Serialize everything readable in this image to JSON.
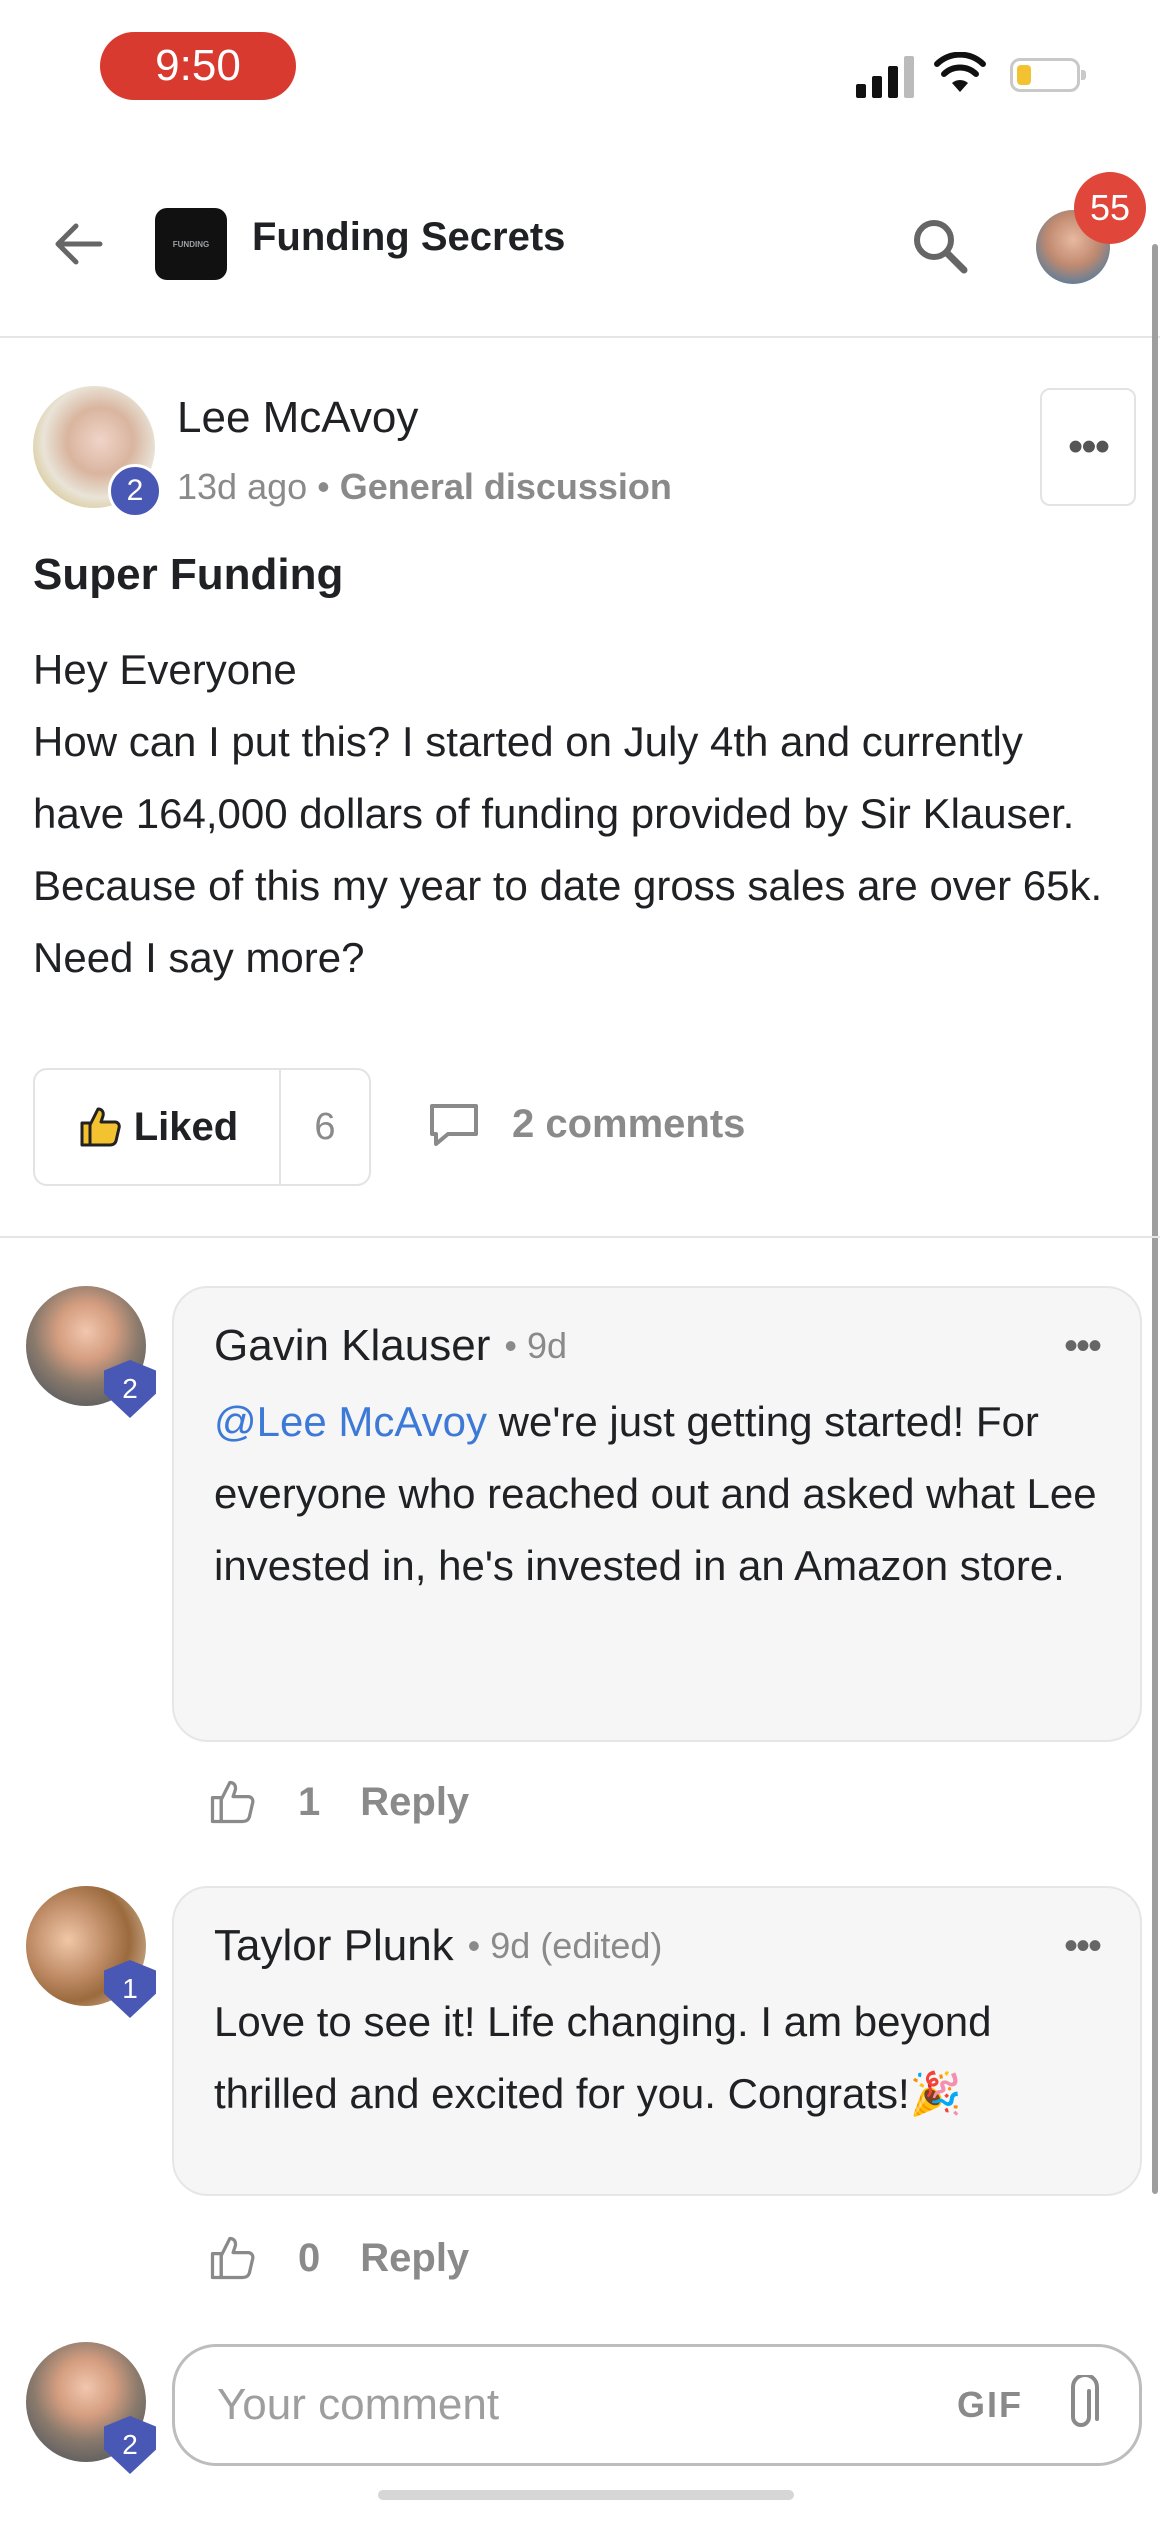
{
  "status_bar": {
    "time": "9:50"
  },
  "header": {
    "group_name": "Funding Secrets",
    "logo_text": "FUNDING",
    "notification_count": "55"
  },
  "post": {
    "author": "Lee McAvoy",
    "author_level": "2",
    "time_ago": "13d ago",
    "separator": "•",
    "category": "General discussion",
    "more": "•••",
    "title": "Super Funding",
    "body_line1": "Hey Everyone",
    "body_line2": "How can I put this? I started on July 4th and currently have 164,000 dollars of funding provided by Sir Klauser. Because of this my year to date gross sales are over 65k. Need I say more?",
    "like_label": "Liked",
    "like_count": "6",
    "comments_label": "2 comments"
  },
  "comments": [
    {
      "author": "Gavin Klauser",
      "level": "2",
      "meta": "• 9d",
      "mention": "@Lee McAvoy",
      "text": " we're just getting started! For everyone who reached out and asked what Lee invested in, he's invested in an Amazon store.",
      "more": "•••",
      "likes": "1",
      "reply_label": "Reply"
    },
    {
      "author": "Taylor Plunk",
      "level": "1",
      "meta": "• 9d (edited)",
      "text": "Love to see it! Life changing. I am beyond thrilled and excited for you. Congrats!🎉",
      "more": "•••",
      "likes": "0",
      "reply_label": "Reply"
    }
  ],
  "composer": {
    "placeholder": "Your comment",
    "value": "",
    "gif_label": "GIF",
    "user_level": "2"
  },
  "colors": {
    "time_pill": "#d93a2f",
    "level_badge": "#4a58b5",
    "mention": "#3d79d6",
    "notification_badge": "#e0473a"
  }
}
